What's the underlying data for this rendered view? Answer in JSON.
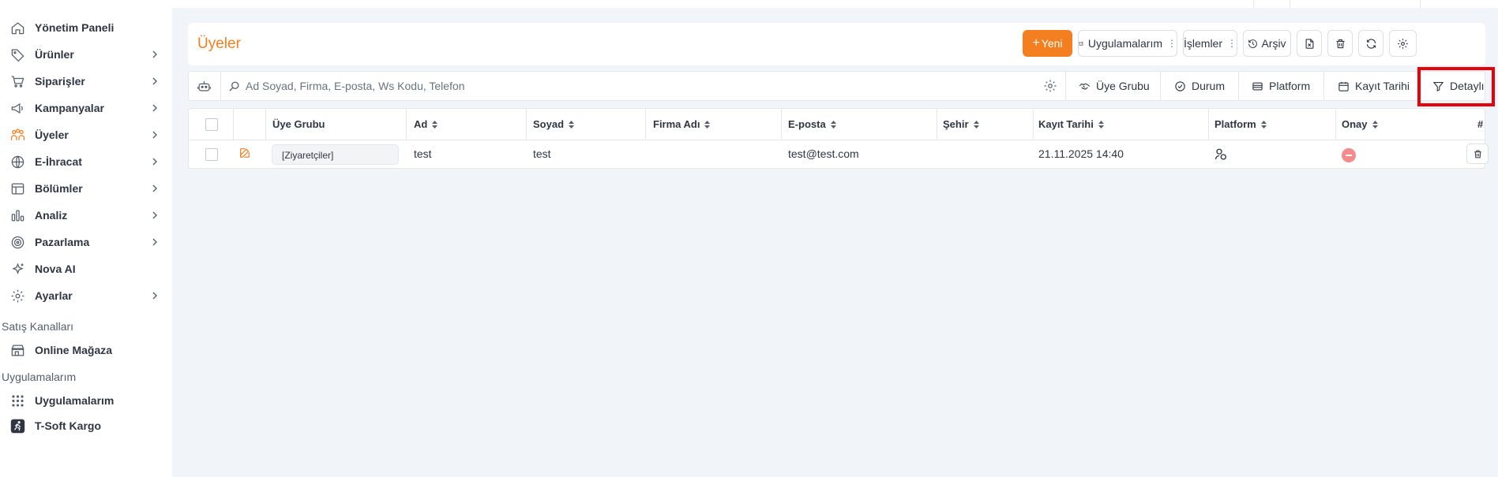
{
  "sidebar": {
    "items": [
      {
        "label": "Yönetim Paneli",
        "icon": "home-icon",
        "has_children": false
      },
      {
        "label": "Ürünler",
        "icon": "tag-icon",
        "has_children": true
      },
      {
        "label": "Siparişler",
        "icon": "cart-icon",
        "has_children": true
      },
      {
        "label": "Kampanyalar",
        "icon": "megaphone-icon",
        "has_children": true
      },
      {
        "label": "Üyeler",
        "icon": "users-icon",
        "has_children": true,
        "active": true
      },
      {
        "label": "E-İhracat",
        "icon": "globe-icon",
        "has_children": true
      },
      {
        "label": "Bölümler",
        "icon": "layout-icon",
        "has_children": true
      },
      {
        "label": "Analiz",
        "icon": "chart-icon",
        "has_children": true
      },
      {
        "label": "Pazarlama",
        "icon": "target-icon",
        "has_children": true
      },
      {
        "label": "Nova AI",
        "icon": "sparkle-icon",
        "has_children": false
      },
      {
        "label": "Ayarlar",
        "icon": "gear-icon",
        "has_children": true
      }
    ],
    "sales_channels_title": "Satış Kanalları",
    "sales_channels": [
      {
        "label": "Online Mağaza",
        "icon": "store-icon"
      }
    ],
    "apps_title": "Uygulamalarım",
    "apps": [
      {
        "label": "Uygulamalarım",
        "icon": "grid-dots-icon"
      },
      {
        "label": "T-Soft Kargo",
        "icon": "runner-icon"
      }
    ]
  },
  "header": {
    "title": "Üyeler",
    "new_label": "Yeni",
    "apps_label": "Uygulamalarım",
    "actions_label": "İşlemler",
    "archive_label": "Arşiv"
  },
  "filter": {
    "search_placeholder": "Ad Soyad, Firma, E-posta, Ws Kodu, Telefon",
    "search_value": "",
    "chips": [
      {
        "label": "Üye Grubu",
        "icon": "handshake-icon"
      },
      {
        "label": "Durum",
        "icon": "check-circle-icon"
      },
      {
        "label": "Platform",
        "icon": "card-icon"
      },
      {
        "label": "Kayıt Tarihi",
        "icon": "calendar-icon"
      },
      {
        "label": "Detaylı",
        "icon": "filter-icon"
      }
    ]
  },
  "table": {
    "columns": [
      "Üye Grubu",
      "Ad",
      "Soyad",
      "Firma Adı",
      "E-posta",
      "Şehir",
      "Kayıt Tarihi",
      "Platform",
      "Onay",
      "#"
    ],
    "rows": [
      {
        "group": "[Ziyaretçiler]",
        "first_name": "test",
        "last_name": "test",
        "company": "",
        "email": "test@test.com",
        "city": "",
        "registered": "21.11.2025 14:40",
        "platform_icon": "users-platform-icon",
        "approved": false
      }
    ]
  },
  "colors": {
    "accent": "#f47f20",
    "highlight": "#e8000b",
    "onay_off": "#f58b8b",
    "page_bg": "#f1f5f9"
  }
}
